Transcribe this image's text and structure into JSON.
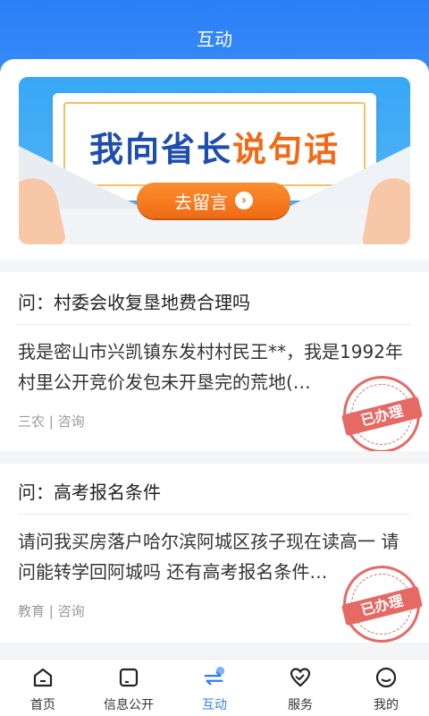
{
  "header": {
    "title": "互动"
  },
  "banner": {
    "title_part1": "我向省长",
    "title_part2": "说句话",
    "cta_label": "去留言"
  },
  "posts": [
    {
      "question": "问：村委会收复垦地费合理吗",
      "body": "我是密山市兴凯镇东发村村民王**，我是1992年村里公开竞价发包未开垦完的荒地(…",
      "tags": "三农 | 咨询",
      "stamp": "已办理"
    },
    {
      "question": "问：高考报名条件",
      "body": "请问我买房落户哈尔滨阿城区孩子现在读高一 请问能转学回阿城吗 还有高考报名条件…",
      "tags": "教育 | 咨询",
      "stamp": "已办理"
    }
  ],
  "tabbar": {
    "items": [
      {
        "label": "首页",
        "icon": "home-icon"
      },
      {
        "label": "信息公开",
        "icon": "document-icon"
      },
      {
        "label": "互动",
        "icon": "interact-icon",
        "active": true
      },
      {
        "label": "服务",
        "icon": "heart-hands-icon"
      },
      {
        "label": "我的",
        "icon": "profile-icon"
      }
    ]
  },
  "colors": {
    "accent": "#2b7ff6",
    "banner_orange": "#f06a14",
    "banner_blue": "#1e4db0",
    "stamp_red": "#e2504a"
  }
}
